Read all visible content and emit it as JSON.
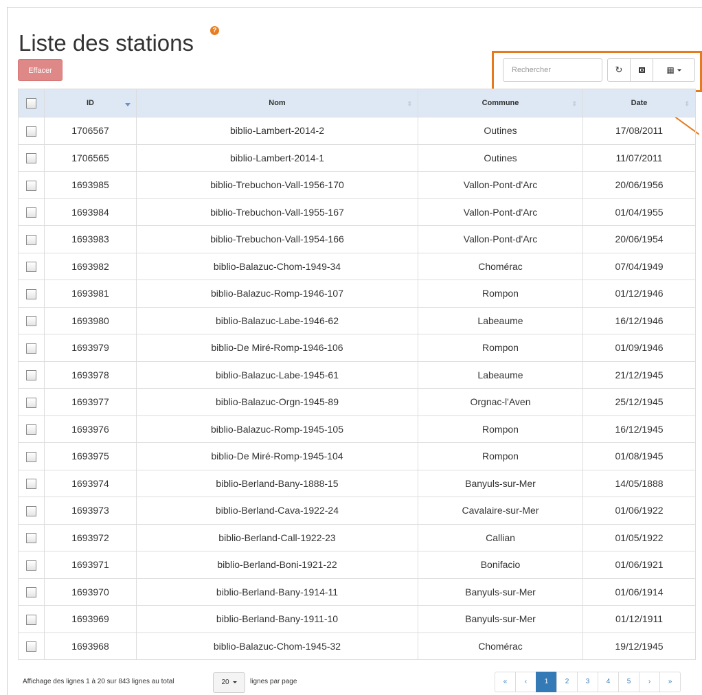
{
  "page": {
    "title": "Liste des stations",
    "help_icon": "?"
  },
  "toolbar": {
    "delete_label": "Effacer",
    "search_placeholder": "Rechercher",
    "refresh_icon": "↻",
    "columns_icon": "▦"
  },
  "table": {
    "headers": {
      "id": "ID",
      "nom": "Nom",
      "commune": "Commune",
      "date": "Date"
    },
    "rows": [
      {
        "id": "1706567",
        "nom": "biblio-Lambert-2014-2",
        "commune": "Outines",
        "date": "17/08/2011"
      },
      {
        "id": "1706565",
        "nom": "biblio-Lambert-2014-1",
        "commune": "Outines",
        "date": "11/07/2011"
      },
      {
        "id": "1693985",
        "nom": "biblio-Trebuchon-Vall-1956-170",
        "commune": "Vallon-Pont-d'Arc",
        "date": "20/06/1956"
      },
      {
        "id": "1693984",
        "nom": "biblio-Trebuchon-Vall-1955-167",
        "commune": "Vallon-Pont-d'Arc",
        "date": "01/04/1955"
      },
      {
        "id": "1693983",
        "nom": "biblio-Trebuchon-Vall-1954-166",
        "commune": "Vallon-Pont-d'Arc",
        "date": "20/06/1954"
      },
      {
        "id": "1693982",
        "nom": "biblio-Balazuc-Chom-1949-34",
        "commune": "Chomérac",
        "date": "07/04/1949"
      },
      {
        "id": "1693981",
        "nom": "biblio-Balazuc-Romp-1946-107",
        "commune": "Rompon",
        "date": "01/12/1946"
      },
      {
        "id": "1693980",
        "nom": "biblio-Balazuc-Labe-1946-62",
        "commune": "Labeaume",
        "date": "16/12/1946"
      },
      {
        "id": "1693979",
        "nom": "biblio-De Miré-Romp-1946-106",
        "commune": "Rompon",
        "date": "01/09/1946"
      },
      {
        "id": "1693978",
        "nom": "biblio-Balazuc-Labe-1945-61",
        "commune": "Labeaume",
        "date": "21/12/1945"
      },
      {
        "id": "1693977",
        "nom": "biblio-Balazuc-Orgn-1945-89",
        "commune": "Orgnac-l'Aven",
        "date": "25/12/1945"
      },
      {
        "id": "1693976",
        "nom": "biblio-Balazuc-Romp-1945-105",
        "commune": "Rompon",
        "date": "16/12/1945"
      },
      {
        "id": "1693975",
        "nom": "biblio-De Miré-Romp-1945-104",
        "commune": "Rompon",
        "date": "01/08/1945"
      },
      {
        "id": "1693974",
        "nom": "biblio-Berland-Bany-1888-15",
        "commune": "Banyuls-sur-Mer",
        "date": "14/05/1888"
      },
      {
        "id": "1693973",
        "nom": "biblio-Berland-Cava-1922-24",
        "commune": "Cavalaire-sur-Mer",
        "date": "01/06/1922"
      },
      {
        "id": "1693972",
        "nom": "biblio-Berland-Call-1922-23",
        "commune": "Callian",
        "date": "01/05/1922"
      },
      {
        "id": "1693971",
        "nom": "biblio-Berland-Boni-1921-22",
        "commune": "Bonifacio",
        "date": "01/06/1921"
      },
      {
        "id": "1693970",
        "nom": "biblio-Berland-Bany-1914-11",
        "commune": "Banyuls-sur-Mer",
        "date": "01/06/1914"
      },
      {
        "id": "1693969",
        "nom": "biblio-Berland-Bany-1911-10",
        "commune": "Banyuls-sur-Mer",
        "date": "01/12/1911"
      },
      {
        "id": "1693968",
        "nom": "biblio-Balazuc-Chom-1945-32",
        "commune": "Chomérac",
        "date": "19/12/1945"
      }
    ]
  },
  "footer": {
    "info": "Affichage des lignes 1 à 20 sur 843 lignes au total",
    "page_size": "20",
    "page_size_suffix": "lignes par page"
  },
  "pagination": {
    "first": "«",
    "prev": "‹",
    "pages": [
      "1",
      "2",
      "3",
      "4",
      "5"
    ],
    "next": "›",
    "last": "»",
    "current": "1"
  },
  "colors": {
    "accent": "#e67b1e",
    "header_bg": "#dde8f4",
    "delete_button": "#de8888",
    "active_page": "#337ab7"
  }
}
